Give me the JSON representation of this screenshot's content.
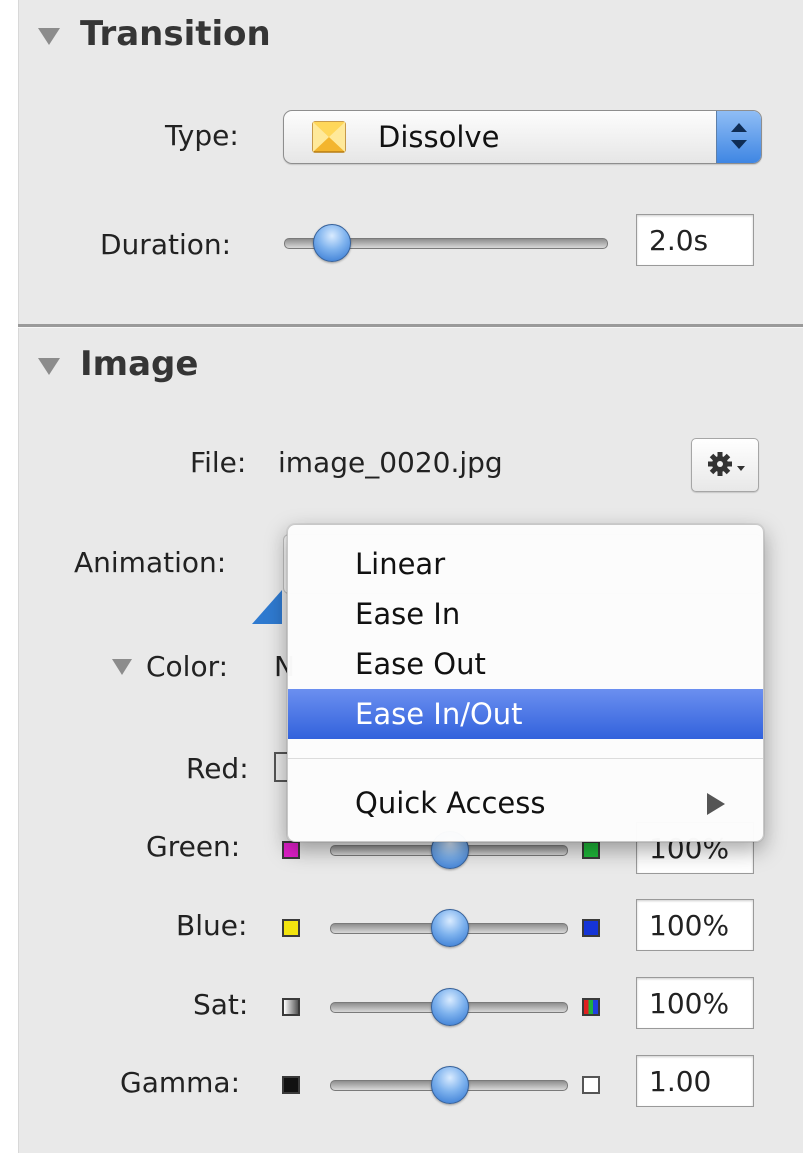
{
  "transition": {
    "title": "Transition",
    "type_label": "Type:",
    "type_value": "Dissolve",
    "duration_label": "Duration:",
    "duration_value": "2.0s"
  },
  "image": {
    "title": "Image",
    "file_label": "File:",
    "file_value": "image_0020.jpg",
    "animation_label": "Animation:",
    "color_label": "Color:",
    "color_value_fragment": "N",
    "adjustments": [
      {
        "label": "Red:",
        "value": ""
      },
      {
        "label": "Green:",
        "value": "100%"
      },
      {
        "label": "Blue:",
        "value": "100%"
      },
      {
        "label": "Sat:",
        "value": "100%"
      },
      {
        "label": "Gamma:",
        "value": "1.00"
      }
    ]
  },
  "animation_menu": {
    "items": [
      "Linear",
      "Ease In",
      "Ease Out",
      "Ease In/Out"
    ],
    "selected": "Ease In/Out",
    "submenu_item": "Quick Access"
  },
  "colors": {
    "panel_bg": "#e9e9e9",
    "menu_selection": "#3f6ee0",
    "slider_knob": "#5b97e6"
  },
  "icons": {
    "disclosure": "triangle-down-icon",
    "transition_type": "dissolve-icon",
    "popup_stepper": "up-down-arrows-icon",
    "file_action": "gear-icon",
    "submenu": "chevron-right-icon"
  }
}
